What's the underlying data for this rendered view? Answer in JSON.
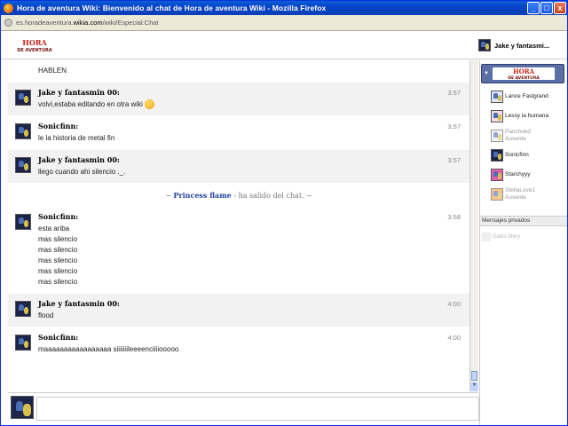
{
  "window": {
    "title": "Hora de aventura Wiki: Bienvenido al chat de Hora de aventura Wiki - Mozilla Firefox",
    "minimize": "_",
    "maximize": "□",
    "close": "x"
  },
  "urlbar": {
    "url_prefix": "es.horadeaventura.",
    "url_domain": "wikia.com",
    "url_suffix": "/wiki/Especial:Chat"
  },
  "header": {
    "logo_line1": "HORA",
    "logo_line2": "DE AVENTURA",
    "current_user": "Jake y fantasmi..."
  },
  "messages": [
    {
      "type": "continuation",
      "lines": [
        "HABLEN"
      ],
      "alt": false
    },
    {
      "type": "msg",
      "user": "Jake y fantasmin 00:",
      "time": "3:57",
      "lines": [
        "volvi,estaba editando en otra wiki"
      ],
      "emoji": true,
      "alt": true
    },
    {
      "type": "msg",
      "user": "Sonicfinn:",
      "time": "3:57",
      "lines": [
        "le la historia de metal fin"
      ],
      "alt": false
    },
    {
      "type": "msg",
      "user": "Jake y fantasmin 00:",
      "time": "3:57",
      "lines": [
        "llego cuando ahi silencio ._."
      ],
      "alt": true
    },
    {
      "type": "system",
      "prefix": "~ ",
      "user": "Princess flame",
      "text": "- ha salido del chat. ~"
    },
    {
      "type": "msg",
      "user": "Sonicfinn:",
      "time": "3:58",
      "lines": [
        "esta ariba",
        "mas silencio",
        "mas silencio",
        "mas silencio",
        "mas silencio",
        "mas silencio"
      ],
      "alt": false
    },
    {
      "type": "msg",
      "user": "Jake y fantasmin 00:",
      "time": "4:00",
      "lines": [
        "flood"
      ],
      "alt": true
    },
    {
      "type": "msg",
      "user": "Sonicfinn:",
      "time": "4:00",
      "lines": [
        "maaaaaaaaaaaaaaaaa siiiiiiileeeenciiiiooooo"
      ],
      "alt": false
    }
  ],
  "sidebar": {
    "users": [
      {
        "name": "Lance Fastgrand",
        "status": "",
        "away": false,
        "color": "#dfe7ff"
      },
      {
        "name": "Lessy la humana",
        "status": "",
        "away": false,
        "color": "#f2dede"
      },
      {
        "name": "Panchokd",
        "status": "Ausente",
        "away": true,
        "color": "#eeeeee"
      },
      {
        "name": "Sonicfinn",
        "status": "",
        "away": false,
        "color": "#1c2448"
      },
      {
        "name": "Starchyyy",
        "status": "",
        "away": false,
        "color": "#e85fb0"
      },
      {
        "name": "StellaLove1",
        "status": "Ausente",
        "away": true,
        "color": "#f0a040"
      }
    ],
    "pm_header": "Mensajes privados",
    "pm_user": "Gatita Mery"
  },
  "input": {
    "placeholder": ""
  },
  "colors": {
    "titlebar": "#0a5fd8",
    "system_user": "#2045a0",
    "wiki_item_bg": "#5a6fa6"
  }
}
